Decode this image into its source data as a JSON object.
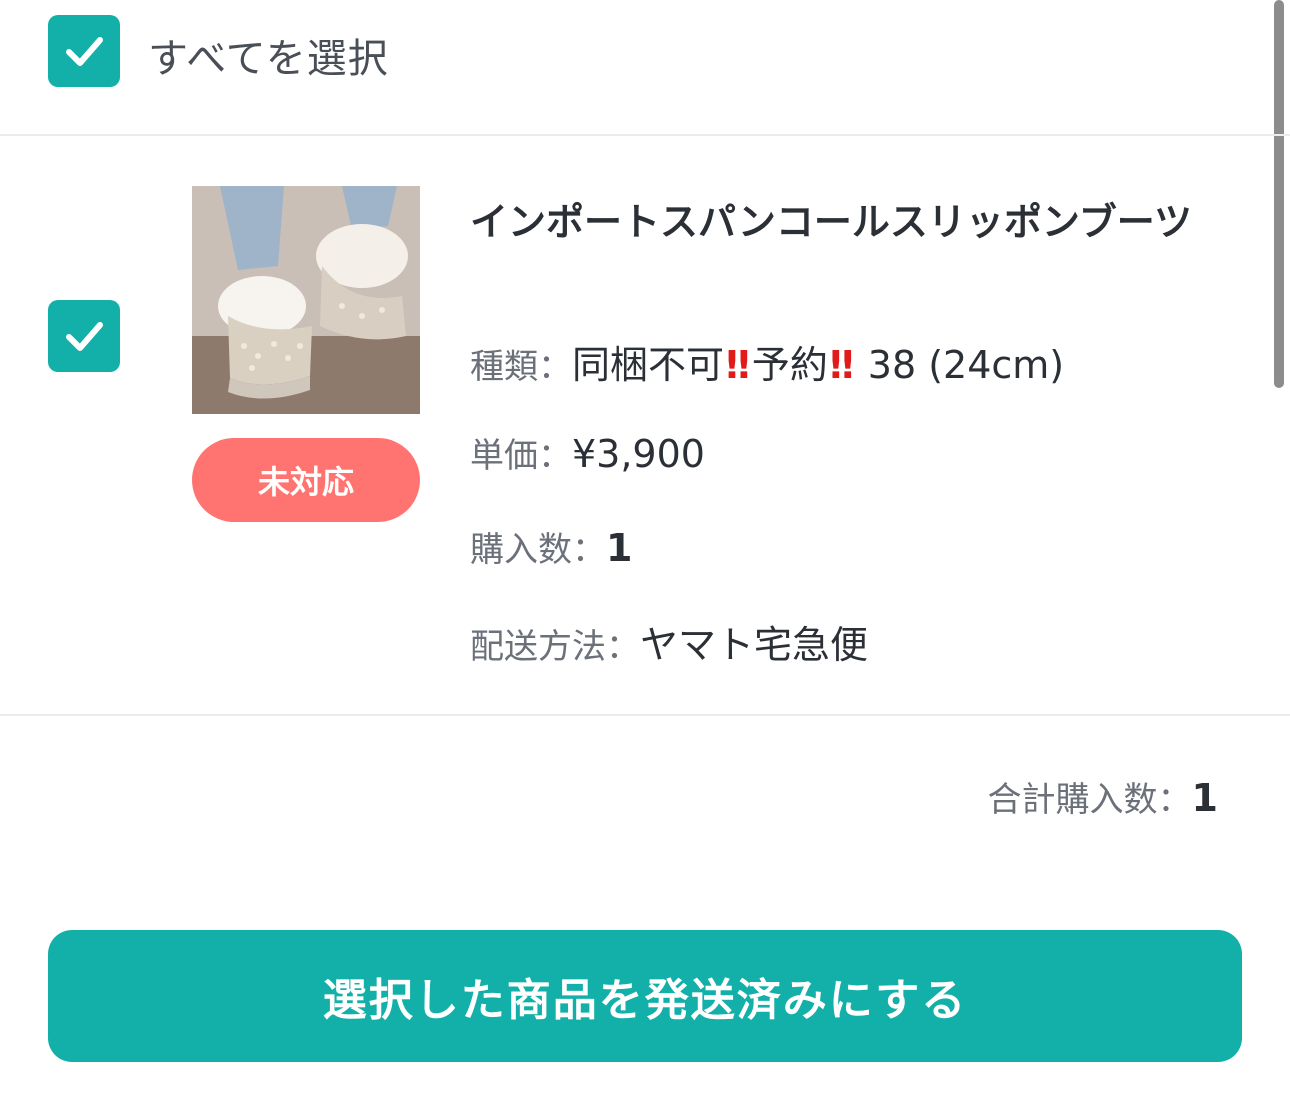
{
  "select_all": {
    "label": "すべてを選択",
    "checked": true
  },
  "item": {
    "checked": true,
    "title": "インポートスパンコールスリッポンブーツ",
    "status": "未対応",
    "variant": {
      "label": "種類：",
      "value_part1": "同梱不可",
      "mark1": "‼",
      "value_part2": "予約",
      "mark2": "‼",
      "value_part3": " 38 (24cm)"
    },
    "price": {
      "label": "単価：",
      "value": "¥3,900"
    },
    "quantity": {
      "label": "購入数：",
      "value": "1"
    },
    "shipping": {
      "label": "配送方法：",
      "value": "ヤマト宅急便"
    }
  },
  "total": {
    "label": "合計購入数：",
    "value": "1"
  },
  "submit_button": {
    "label": "選択した商品を発送済みにする"
  },
  "colors": {
    "accent": "#12b0a8",
    "status_badge": "#ff7470",
    "exclamation": "#e11a1a"
  },
  "icons": {
    "checkbox": "checkmark-icon"
  }
}
